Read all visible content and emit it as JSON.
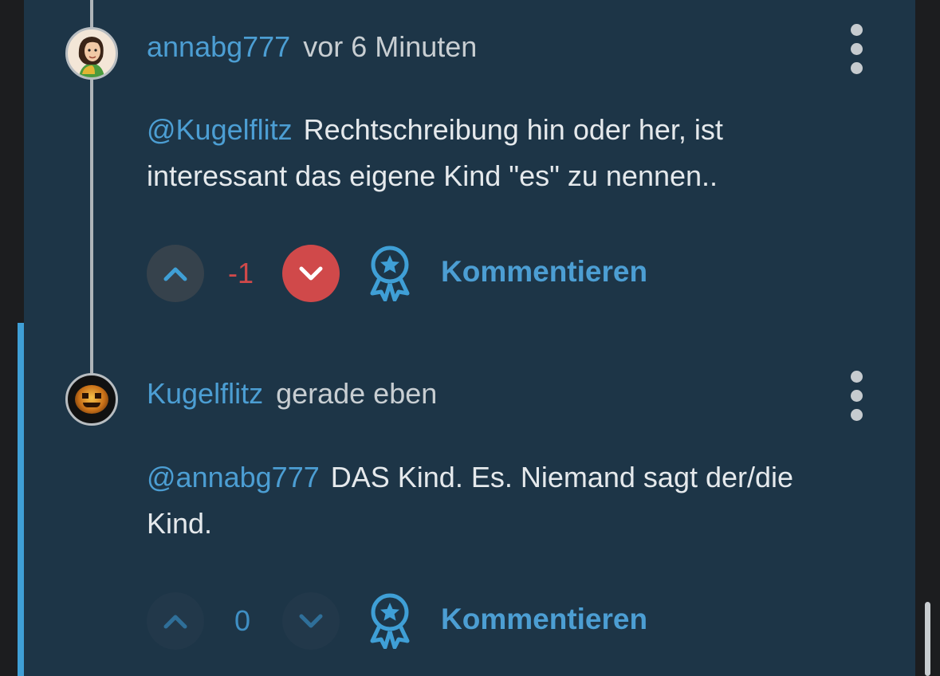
{
  "comments": [
    {
      "username": "annabg777",
      "time": "vor 6 Minuten",
      "mention": "@Kugelflitz",
      "text": "Rechtschreibung hin oder her, ist interessant das eigene Kind \"es\" zu nennen..",
      "score": "-1",
      "comment_label": "Kommentieren",
      "vote_state": "downvoted"
    },
    {
      "username": "Kugelflitz",
      "time": "gerade eben",
      "mention": "@annabg777",
      "text": "DAS Kind. Es. Niemand sagt der/die Kind.",
      "score": "0",
      "comment_label": "Kommentieren",
      "vote_state": "none"
    }
  ],
  "icons": {
    "upvote": "chevron-up-icon",
    "downvote": "chevron-down-icon",
    "award": "award-ribbon-icon",
    "more": "more-vertical-icon"
  },
  "colors": {
    "background": "#1d3547",
    "accent": "#4c9ed3",
    "downvote_active": "#d0494a",
    "text": "#e5e9ec"
  }
}
